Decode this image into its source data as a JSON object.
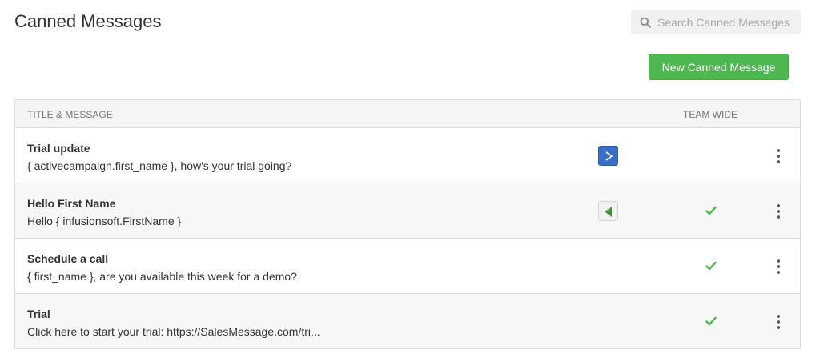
{
  "page": {
    "title": "Canned Messages"
  },
  "search": {
    "placeholder": "Search Canned Messages"
  },
  "actions": {
    "new_label": "New Canned Message"
  },
  "colors": {
    "primary_button": "#4db850",
    "check": "#4db850",
    "activecampaign": "#3a6fc4"
  },
  "table": {
    "headers": {
      "title_message": "TITLE & MESSAGE",
      "team_wide": "TEAM WIDE"
    },
    "rows": [
      {
        "title": "Trial update",
        "message": "{ activecampaign.first_name }, how's your trial going?",
        "integration": "activecampaign-icon",
        "team_wide": false
      },
      {
        "title": "Hello First Name",
        "message": "Hello { infusionsoft.FirstName }",
        "integration": "infusionsoft-icon",
        "team_wide": true
      },
      {
        "title": "Schedule a call",
        "message": "{ first_name }, are you available this week for a demo?",
        "integration": null,
        "team_wide": true
      },
      {
        "title": "Trial",
        "message": "Click here to start your trial: https://SalesMessage.com/tri...",
        "integration": null,
        "team_wide": true
      }
    ]
  }
}
